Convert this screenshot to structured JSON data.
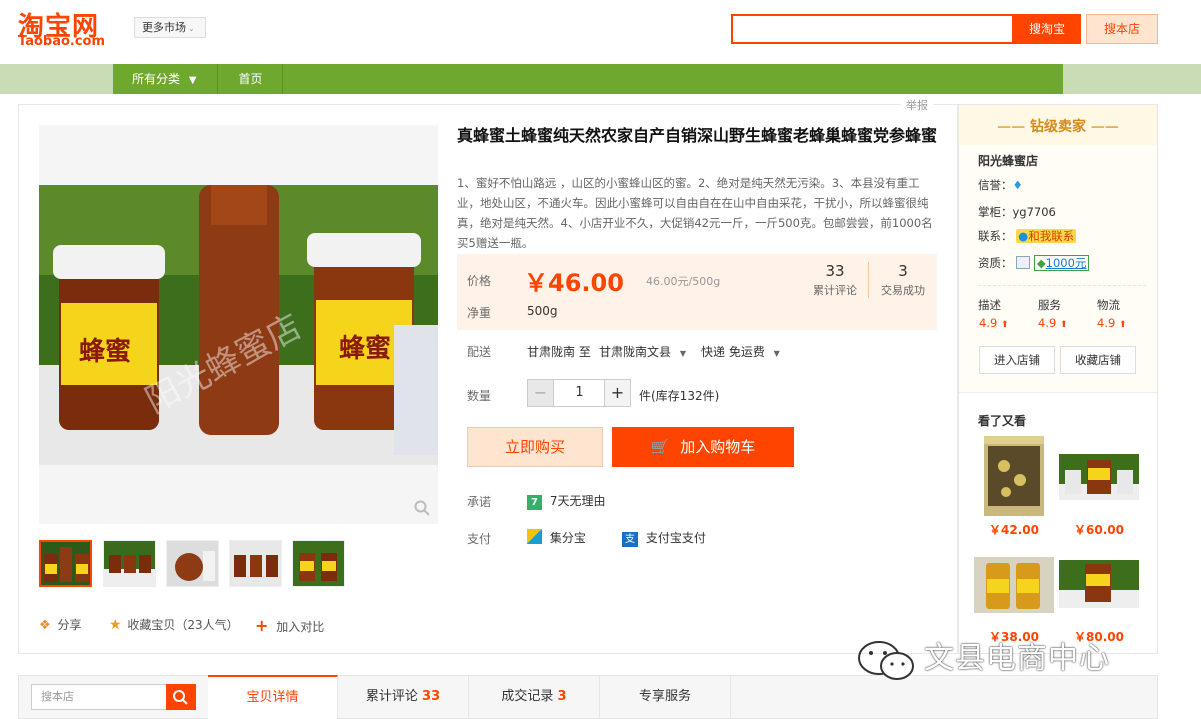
{
  "header": {
    "logo_cn": "淘宝网",
    "logo_en": "Taobao.com",
    "market_label": "更多市场",
    "search_value": "",
    "search_btn": "搜淘宝",
    "store_btn": "搜本店"
  },
  "nav": {
    "all_categories": "所有分类",
    "home": "首页"
  },
  "report": "举报",
  "product": {
    "title": "真蜂蜜土蜂蜜纯天然农家自产自销深山野生蜂蜜老蜂巢蜂蜜党参蜂蜜",
    "description": "1、蜜好不怕山路远 ，山区的小蜜蜂山区的蜜。2、绝对是纯天然无污染。3、本县没有重工业，地处山区，不通火车。因此小蜜蜂可以自由自在在山中自由采花，干扰小，所以蜂蜜很纯真，绝对是纯天然。4、小店开业不久，大促销42元一斤，一斤500克。包邮尝尝，前1000名买5赠送一瓶。",
    "image_watermark": "阳光蜂蜜店",
    "price_label": "价格",
    "price": "￥46.00",
    "unit_price": "46.00元/500g",
    "reviews_count": "33",
    "reviews_label": "累计评论",
    "sales_count": "3",
    "sales_label": "交易成功",
    "weight_label": "净重",
    "weight": "500g",
    "delivery_label": "配送",
    "delivery_from": "甘肃陇南 至",
    "delivery_to": "甘肃陇南文县",
    "shipping": "快递 免运费",
    "qty_label": "数量",
    "qty_minus": "−",
    "qty": "1",
    "qty_plus": "+",
    "stock": "件(库存132件)",
    "buy_now": "立即购买",
    "add_cart": "加入购物车",
    "promise_label": "承诺",
    "promise": "7天无理由",
    "payment_label": "支付",
    "pay1": "集分宝",
    "pay2": "支付宝支付"
  },
  "actions": {
    "share": "分享",
    "favorite": "收藏宝贝（23人气）",
    "compare": "加入对比"
  },
  "seller": {
    "badge": "钻级卖家",
    "shop_name": "阳光蜂蜜店",
    "credit_label": "信誉：",
    "owner_label": "掌柜：",
    "owner": "yg7706",
    "contact_label": "联系：",
    "contact": "和我联系",
    "qualification_label": "资质：",
    "deposit": "1000元",
    "desc_label": "描述",
    "desc_score": "4.9",
    "service_label": "服务",
    "service_score": "4.9",
    "logistics_label": "物流",
    "logistics_score": "4.9",
    "enter_shop": "进入店铺",
    "fav_shop": "收藏店铺"
  },
  "recommend": {
    "title": "看了又看",
    "items": [
      {
        "price": "￥42.00"
      },
      {
        "price": "￥60.00"
      },
      {
        "price": "￥38.00"
      },
      {
        "price": "￥80.00"
      }
    ]
  },
  "tabs": {
    "shop_search_placeholder": "搜本店",
    "details": "宝贝详情",
    "reviews": "累计评论",
    "reviews_num": "33",
    "records": "成交记录",
    "records_num": "3",
    "service": "专享服务"
  },
  "watermark": "文县电商中心",
  "colors": {
    "brand": "#ff4400",
    "nav_green": "#6fa82e"
  }
}
